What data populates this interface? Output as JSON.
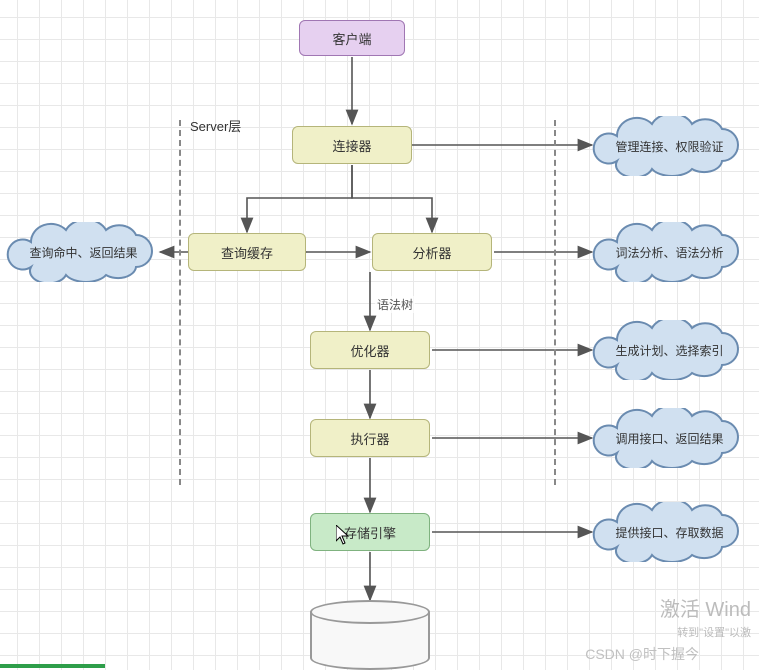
{
  "chart_data": {
    "type": "flowchart",
    "title": "",
    "nodes": [
      {
        "id": "client",
        "label": "客户端",
        "kind": "terminal",
        "color": "purple"
      },
      {
        "id": "connector",
        "label": "连接器",
        "kind": "process",
        "color": "yellow"
      },
      {
        "id": "cache",
        "label": "查询缓存",
        "kind": "process",
        "color": "yellow"
      },
      {
        "id": "analyzer",
        "label": "分析器",
        "kind": "process",
        "color": "yellow"
      },
      {
        "id": "optimizer",
        "label": "优化器",
        "kind": "process",
        "color": "yellow"
      },
      {
        "id": "executor",
        "label": "执行器",
        "kind": "process",
        "color": "yellow"
      },
      {
        "id": "storage",
        "label": "存储引擎",
        "kind": "process",
        "color": "green"
      },
      {
        "id": "db",
        "label": "",
        "kind": "datastore"
      }
    ],
    "annotations": [
      {
        "for": "connector",
        "text": "管理连接、权限验证",
        "side": "right"
      },
      {
        "for": "cache",
        "text": "查询命中、返回结果",
        "side": "left"
      },
      {
        "for": "analyzer",
        "text": "词法分析、语法分析",
        "side": "right"
      },
      {
        "for": "optimizer",
        "text": "生成计划、选择索引",
        "side": "right"
      },
      {
        "for": "executor",
        "text": "调用接口、返回结果",
        "side": "right"
      },
      {
        "for": "storage",
        "text": "提供接口、存取数据",
        "side": "right"
      }
    ],
    "groups": [
      {
        "label": "Server层",
        "members": [
          "connector",
          "cache",
          "analyzer",
          "optimizer",
          "executor"
        ]
      }
    ],
    "edges": [
      {
        "from": "client",
        "to": "connector"
      },
      {
        "from": "connector",
        "to": "cache"
      },
      {
        "from": "connector",
        "to": "analyzer"
      },
      {
        "from": "cache",
        "to": "analyzer",
        "bidirectional": true
      },
      {
        "from": "analyzer",
        "to": "optimizer",
        "label": "语法树"
      },
      {
        "from": "optimizer",
        "to": "executor"
      },
      {
        "from": "executor",
        "to": "storage"
      },
      {
        "from": "storage",
        "to": "db"
      }
    ]
  },
  "nodes": {
    "client": {
      "label": "客户端"
    },
    "connector": {
      "label": "连接器"
    },
    "cache": {
      "label": "查询缓存"
    },
    "analyzer": {
      "label": "分析器"
    },
    "optimizer": {
      "label": "优化器"
    },
    "executor": {
      "label": "执行器"
    },
    "storage": {
      "label": "存储引擎"
    }
  },
  "clouds": {
    "connector_note": "管理连接、权限验证",
    "cache_note": "查询命中、返回结果",
    "analyzer_note": "词法分析、语法分析",
    "optimizer_note": "生成计划、选择索引",
    "executor_note": "调用接口、返回结果",
    "storage_note": "提供接口、存取数据"
  },
  "group_label": "Server层",
  "edge_labels": {
    "syntax_tree": "语法树"
  },
  "watermark": {
    "main": "激活 Wind",
    "sub": "转到\"设置\"以激",
    "csdn": "CSDN @时下握今"
  }
}
